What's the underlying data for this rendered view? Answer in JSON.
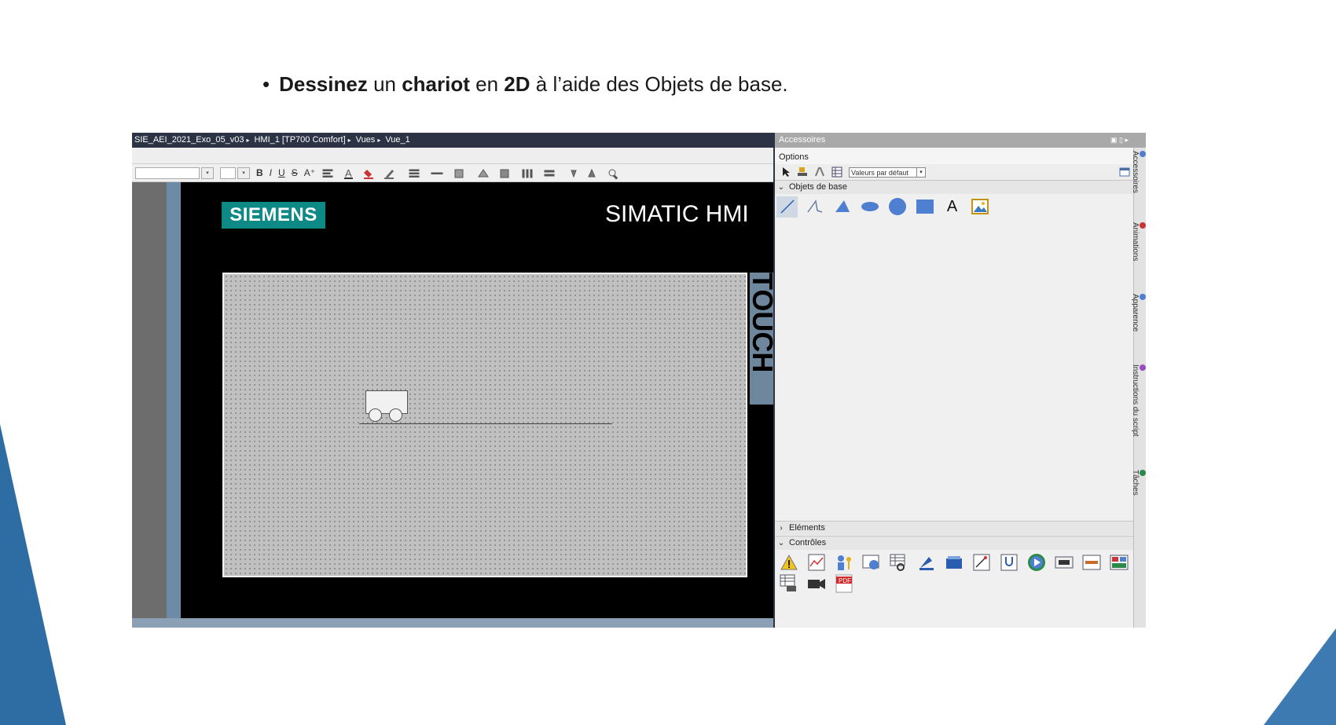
{
  "slide": {
    "bullet": "•",
    "parts": [
      "Dessinez",
      " un ",
      "chariot",
      " en ",
      "2D",
      " à l’aide des Objets de base."
    ]
  },
  "breadcrumb": {
    "items": [
      "SIE_AEI_2021_Exo_05_v03",
      "HMI_1 [TP700 Comfort]",
      "Vues",
      "Vue_1"
    ],
    "separator": "▸"
  },
  "toolbar": {
    "bold": "B",
    "italic": "I",
    "underline": "U",
    "strike": "S",
    "font_size": "A⁺"
  },
  "hmi": {
    "brand": "SIEMENS",
    "product": "SIMATIC HMI",
    "touch_label": "TOUCH",
    "brand_color": "#0d8a85"
  },
  "accessories": {
    "title": "Accessoires",
    "options_label": "Options",
    "style_select": "Valeurs par défaut",
    "sections": {
      "basic": "Objets de base",
      "elements": "Eléments",
      "controls": "Contrôles"
    },
    "text_tool": "A",
    "pdf_label": "PDF",
    "side_tabs": [
      "Accessoires",
      "Animations",
      "Apparence",
      "Instructions du script",
      "Tâches"
    ]
  }
}
